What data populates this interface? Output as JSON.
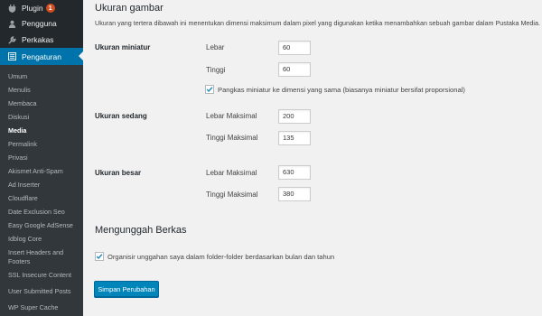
{
  "sidebar": {
    "top_items": [
      {
        "label": "Plugin",
        "badge": "1",
        "icon": "plugin-icon"
      },
      {
        "label": "Pengguna",
        "icon": "users-icon"
      },
      {
        "label": "Perkakas",
        "icon": "wrench-icon"
      },
      {
        "label": "Pengaturan",
        "icon": "settings-icon"
      }
    ],
    "sub_items": [
      "Umum",
      "Menulis",
      "Membaca",
      "Diskusi",
      "Media",
      "Permalink",
      "Privasi",
      "Akismet Anti-Spam",
      "Ad Inserter",
      "Cloudflare",
      "Date Exclusion Seo",
      "Easy Google AdSense",
      "Idblog Core",
      "Insert Headers and Footers",
      "SSL Insecure Content",
      "User Submitted Posts",
      "WP Super Cache"
    ],
    "current_sub": "Media",
    "accent_color": "#0073aa"
  },
  "main": {
    "title_sizes": "Ukuran gambar",
    "description": "Ukuran yang tertera dibawah ini menentukan dimensi maksimum dalam pixel yang digunakan ketika menambahkan sebuah gambar dalam Pustaka Media.",
    "thumbnail": {
      "label": "Ukuran miniatur",
      "width_label": "Lebar",
      "width": "60",
      "height_label": "Tinggi",
      "height": "60",
      "crop_label": "Pangkas miniatur ke dimensi yang sama (biasanya miniatur bersifat proporsional)",
      "crop_checked": true
    },
    "medium": {
      "label": "Ukuran sedang",
      "width_label": "Lebar Maksimal",
      "width": "200",
      "height_label": "Tinggi Maksimal",
      "height": "135"
    },
    "large": {
      "label": "Ukuran besar",
      "width_label": "Lebar Maksimal",
      "width": "630",
      "height_label": "Tinggi Maksimal",
      "height": "380"
    },
    "title_upload": "Mengunggah Berkas",
    "organize_label": "Organisir unggahan saya dalam folder-folder berdasarkan bulan dan tahun",
    "organize_checked": true,
    "save_label": "Simpan Perubahan"
  }
}
